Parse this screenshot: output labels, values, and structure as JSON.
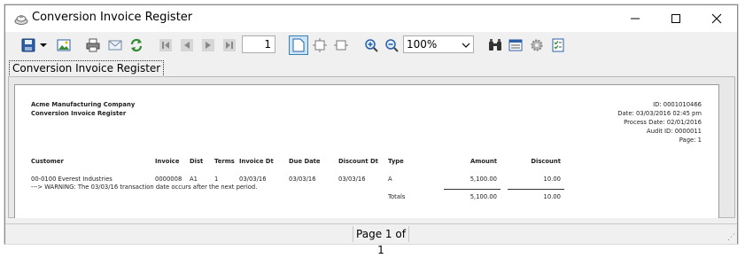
{
  "window": {
    "title": "Conversion Invoice Register"
  },
  "toolbar": {
    "page_number": "1",
    "zoom_value": "100%"
  },
  "document_tab": {
    "label": "Conversion Invoice Register"
  },
  "report": {
    "company": "Acme Manufacturing Company",
    "report_title": "Conversion Invoice Register",
    "id_line": "ID: 0001010466",
    "date_line": "Date: 03/03/2016 02:45 pm",
    "process_date_line": "Process Date: 02/01/2016",
    "audit_line": "Audit ID: 0000011",
    "page_line": "Page: 1",
    "columns": {
      "customer": "Customer",
      "invoice": "Invoice",
      "dist": "Dist",
      "terms": "Terms",
      "invoice_dt": "Invoice Dt",
      "due_date": "Due Date",
      "discount_dt": "Discount Dt",
      "type": "Type",
      "amount": "Amount",
      "discount": "Discount"
    },
    "row": {
      "customer": "00-0100 Everest Industries",
      "invoice": "0000008",
      "dist": "A1",
      "terms": "1",
      "invoice_dt": "03/03/16",
      "due_date": "03/03/16",
      "discount_dt": "03/03/16",
      "type": "A",
      "amount": "5,100.00",
      "discount": "10.00"
    },
    "warning": "---> WARNING: The 03/03/16 transaction date occurs after the next period.",
    "totals": {
      "label": "Totals",
      "amount": "5,100.00",
      "discount": "10.00"
    }
  },
  "status": {
    "page_text": "Page 1 of 1"
  }
}
